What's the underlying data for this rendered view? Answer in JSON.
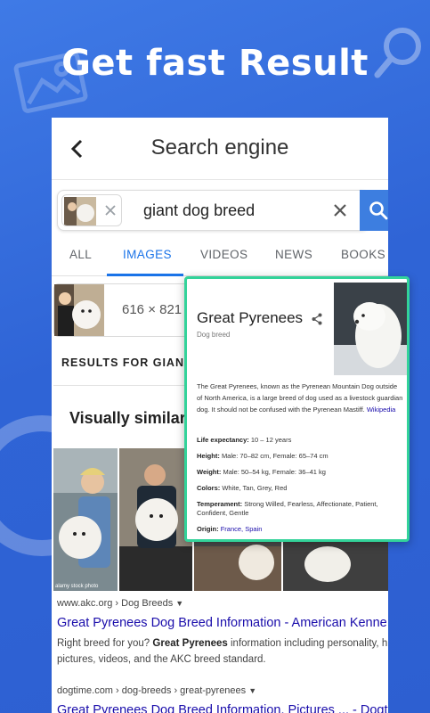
{
  "promo": {
    "title": "Get fast Result"
  },
  "appbar": {
    "title": "Search engine"
  },
  "search": {
    "query": "giant dog breed"
  },
  "tabs": [
    "ALL",
    "IMAGES",
    "VIDEOS",
    "NEWS",
    "BOOKS"
  ],
  "active_tab": "IMAGES",
  "image_info": {
    "dimensions": "616 × 821"
  },
  "results_header": "RESULTS FOR GIANT",
  "visually_similar": {
    "title": "Visually similar",
    "watermark": "alamy stock photo"
  },
  "results": [
    {
      "url": "www.akc.org › Dog Breeds",
      "title": "Great Pyrenees Dog Breed Information - American Kenne",
      "snippet_line1_pre": "Right breed for you? ",
      "snippet_line1_bold": "Great Pyrenees",
      "snippet_line1_post": " information including personality, history, gro",
      "snippet_line2": "pictures, videos, and the AKC breed standard."
    },
    {
      "url": "dogtime.com › dog-breeds › great-pyrenees",
      "title": "Great Pyrenees Dog Breed Information, Pictures ... - Dogt"
    }
  ],
  "knowledge_panel": {
    "name": "Great Pyrenees",
    "subtitle": "Dog breed",
    "description": "The Great Pyrenees, known as the Pyrenean Mountain Dog outside of North America, is a large breed of dog used as a livestock guardian dog. It should not be confused with the Pyrenean Mastiff.",
    "source": "Wikipedia",
    "facts": [
      {
        "label": "Life expectancy:",
        "value": "10 – 12 years"
      },
      {
        "label": "Height:",
        "value": "Male: 70–82 cm, Female: 65–74 cm"
      },
      {
        "label": "Weight:",
        "value": "Male: 50–54 kg, Female: 36–41 kg"
      },
      {
        "label": "Colors:",
        "value": "White, Tan, Grey, Red"
      },
      {
        "label": "Temperament:",
        "value": "Strong Willed, Fearless, Affectionate, Patient, Confident, Gentle"
      }
    ],
    "origin_label": "Origin:",
    "origin_value": "France, Spain"
  },
  "colors": {
    "background": "#2f64d6",
    "link": "#1a0dab",
    "accent": "#1a73e8",
    "panel_border": "#33d39a"
  }
}
